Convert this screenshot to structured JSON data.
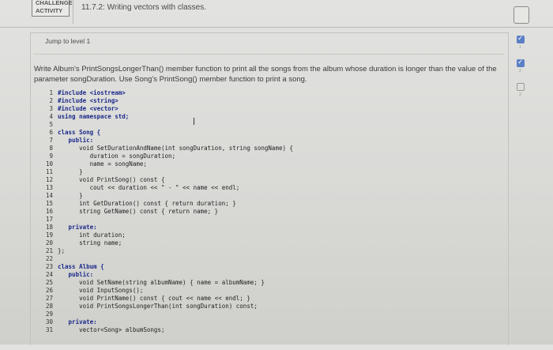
{
  "header": {
    "badge_line1": "CHALLENGE",
    "badge_line2": "ACTIVITY",
    "title": "11.7.2: Writing vectors with classes."
  },
  "progress": [
    {
      "state": "done",
      "num": "1"
    },
    {
      "state": "done",
      "num": "2"
    },
    {
      "state": "todo",
      "num": "3"
    }
  ],
  "jump_link": "Jump to level 1",
  "instructions": "Write Album's PrintSongsLongerThan() member function to print all the songs from the album whose duration is longer than the value of the parameter songDuration. Use Song's PrintSong() member function to print a song.",
  "code": [
    {
      "n": "1",
      "text": "#include <iostream>"
    },
    {
      "n": "2",
      "text": "#include <string>"
    },
    {
      "n": "3",
      "text": "#include <vector>"
    },
    {
      "n": "4",
      "text": "using namespace std;"
    },
    {
      "n": "5",
      "text": ""
    },
    {
      "n": "6",
      "text": "class Song {"
    },
    {
      "n": "7",
      "text": "   public:"
    },
    {
      "n": "8",
      "text": "      void SetDurationAndName(int songDuration, string songName) {"
    },
    {
      "n": "9",
      "text": "         duration = songDuration;"
    },
    {
      "n": "10",
      "text": "         name = songName;"
    },
    {
      "n": "11",
      "text": "      }"
    },
    {
      "n": "12",
      "text": "      void PrintSong() const {"
    },
    {
      "n": "13",
      "text": "         cout << duration << \" - \" << name << endl;"
    },
    {
      "n": "14",
      "text": "      }"
    },
    {
      "n": "15",
      "text": "      int GetDuration() const { return duration; }"
    },
    {
      "n": "16",
      "text": "      string GetName() const { return name; }"
    },
    {
      "n": "17",
      "text": ""
    },
    {
      "n": "18",
      "text": "   private:"
    },
    {
      "n": "19",
      "text": "      int duration;"
    },
    {
      "n": "20",
      "text": "      string name;"
    },
    {
      "n": "21",
      "text": "};"
    },
    {
      "n": "22",
      "text": ""
    },
    {
      "n": "23",
      "text": "class Album {"
    },
    {
      "n": "24",
      "text": "   public:"
    },
    {
      "n": "25",
      "text": "      void SetName(string albumName) { name = albumName; }"
    },
    {
      "n": "26",
      "text": "      void InputSongs();"
    },
    {
      "n": "27",
      "text": "      void PrintName() const { cout << name << endl; }"
    },
    {
      "n": "28",
      "text": "      void PrintSongsLongerThan(int songDuration) const;"
    },
    {
      "n": "29",
      "text": ""
    },
    {
      "n": "30",
      "text": "   private:"
    },
    {
      "n": "31",
      "text": "      vector<Song> albumSongs;"
    }
  ]
}
